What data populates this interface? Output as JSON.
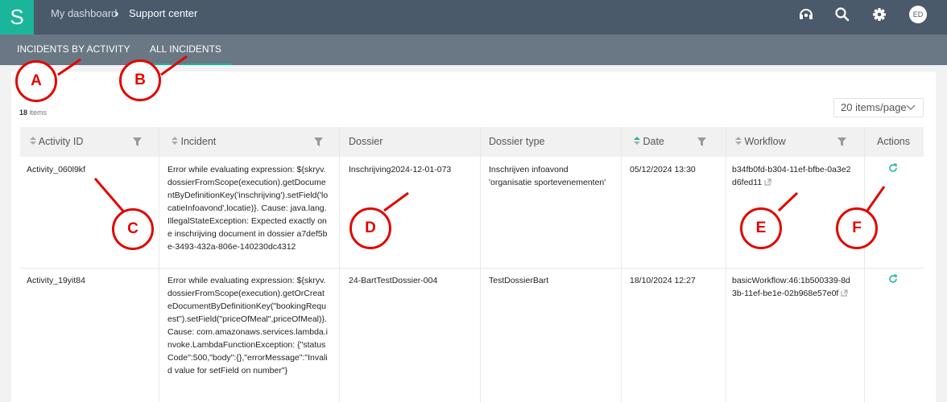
{
  "header": {
    "logo": "S",
    "breadcrumb_home": "My dashboard",
    "breadcrumb_sep": "›",
    "breadcrumb_current": "Support center",
    "avatar_initials": "ED",
    "icons": [
      "headset-icon",
      "search-icon",
      "gear-icon",
      "avatar"
    ]
  },
  "tabs": [
    {
      "label": "INCIDENTS BY ACTIVITY",
      "active": false
    },
    {
      "label": "ALL INCIDENTS",
      "active": true
    }
  ],
  "toolbar": {
    "count_number": "18",
    "count_suffix": "items",
    "page_size": "20 items/page"
  },
  "table": {
    "columns": [
      "Activity ID",
      "Incident",
      "Dossier",
      "Dossier type",
      "Date",
      "Workflow",
      "Actions"
    ],
    "rows": [
      {
        "activity_id": "Activity_060l9kf",
        "incident": "Error while evaluating expression: ${skryv.dossierFromScope(execution).getDocumentByDefinitionKey('inschrijving').setField('locatieInfoavond',locatie)}. Cause: java.lang.IllegalStateException: Expected exactly one inschrijving document in dossier a7def5be-3493-432a-806e-140230dc4312",
        "dossier": "Inschrijving2024-12-01-073",
        "dossier_type": "Inschrijven infoavond 'organisatie sportevenementen'",
        "date": "05/12/2024 13:30",
        "workflow": "b34fb0fd-b304-11ef-bfbe-0a3e2d6fed11"
      },
      {
        "activity_id": "Activity_19yit84",
        "incident": "Error while evaluating expression: ${skryv.dossierFromScope(execution).getOrCreateDocumentByDefinitionKey(\"bookingRequest\").setField(\"priceOfMeal\",priceOfMeal)}. Cause: com.amazonaws.services.lambda.invoke.LambdaFunctionException: {\"statusCode\":500,\"body\":{},\"errorMessage\":\"Invalid value for setField on number\"}",
        "dossier": "24-BartTestDossier-004",
        "dossier_type": "TestDossierBart",
        "date": "18/10/2024 12:27",
        "workflow": "basicWorkflow:46:1b500339-8d3b-11ef-be1e-02b968e57e0f"
      }
    ]
  },
  "annotations": [
    "A",
    "B",
    "C",
    "D",
    "E",
    "F"
  ],
  "colors": {
    "topbar": "#4b5a6a",
    "tabbar": "#6a7784",
    "accent": "#1bb59c",
    "annotation": "#e10600"
  }
}
